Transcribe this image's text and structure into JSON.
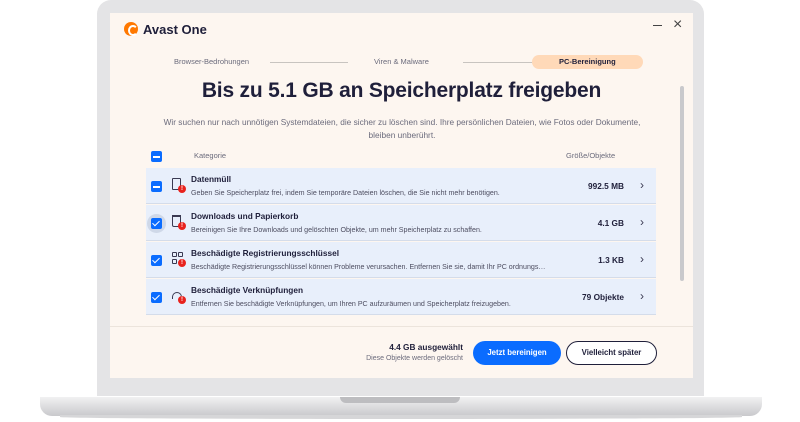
{
  "app": {
    "title": "Avast One"
  },
  "steps": [
    {
      "label": "Browser-Bedrohungen"
    },
    {
      "label": "Viren & Malware"
    },
    {
      "label": "PC-Bereinigung"
    }
  ],
  "heading": {
    "prefix": "Bis zu ",
    "highlight": "5.1 GB an Speicherplatz",
    "suffix": " freigeben"
  },
  "subtitle": "Wir suchen nur nach unnötigen Systemdateien, die sicher zu löschen sind. Ihre persönlichen Dateien, wie Fotos oder Dokumente, bleiben unberührt.",
  "table": {
    "col_category": "Kategorie",
    "col_size": "Größe/Objekte",
    "rows": [
      {
        "title": "Datenmüll",
        "desc": "Geben Sie Speicherplatz frei, indem Sie temporäre Dateien löschen, die Sie nicht mehr benötigen.",
        "size": "992.5 MB",
        "checkbox": "partial",
        "icon": "file-alert-icon"
      },
      {
        "title": "Downloads und Papierkorb",
        "desc": "Bereinigen Sie Ihre Downloads und gelöschten Objekte, um mehr Speicherplatz zu schaffen.",
        "size": "4.1 GB",
        "checkbox": "checked",
        "icon": "trash-alert-icon"
      },
      {
        "title": "Beschädigte Registrierungsschlüssel",
        "desc": "Beschädigte Registrierungsschlüssel können Probleme verursachen. Entfernen Sie sie, damit Ihr PC ordnungsgem...",
        "size": "1.3 KB",
        "checkbox": "checked",
        "icon": "registry-alert-icon"
      },
      {
        "title": "Beschädigte Verknüpfungen",
        "desc": "Entfernen Sie beschädigte Verknüpfungen, um Ihren PC aufzuräumen und Speicherplatz freizugeben.",
        "size": "79 Objekte",
        "checkbox": "checked",
        "icon": "shortcut-alert-icon"
      }
    ]
  },
  "footer": {
    "selected": "4.4 GB ausgewählt",
    "note": "Diese Objekte werden gelöscht",
    "primary_label": "Jetzt bereinigen",
    "secondary_label": "Vielleicht später"
  },
  "colors": {
    "accent": "#0a6cff",
    "brand": "#ff7800",
    "alert": "#e8221d",
    "highlight": "#ff8f73"
  }
}
